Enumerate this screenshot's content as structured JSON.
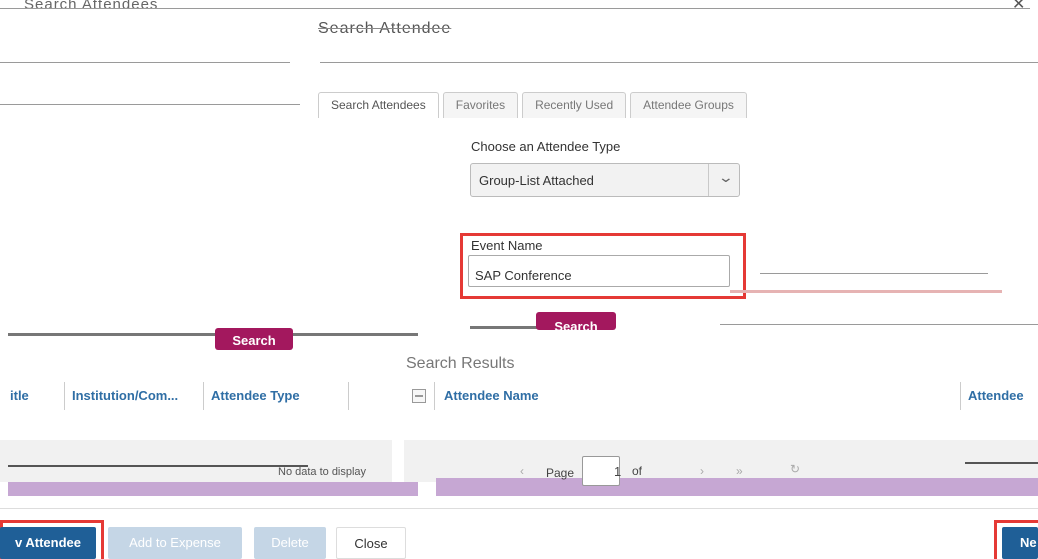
{
  "dialog": {
    "title": "Search Attendees",
    "header_center": "Search Attendee",
    "close_glyph": "✕"
  },
  "tabs": [
    {
      "label": "Search Attendees",
      "active": true
    },
    {
      "label": "Favorites",
      "active": false
    },
    {
      "label": "Recently Used",
      "active": false
    },
    {
      "label": "Attendee Groups",
      "active": false
    }
  ],
  "form": {
    "attendee_type_label": "Choose an Attendee Type",
    "attendee_type_value": "Group-List Attached",
    "event_name_label": "Event Name",
    "event_name_value": "SAP Conference",
    "search_button": "Search"
  },
  "left_grid": {
    "columns": [
      "itle",
      "Institution/Com...",
      "Attendee Type"
    ],
    "no_data": "No data to display"
  },
  "results": {
    "title": "Search Results",
    "columns": [
      "Attendee Name",
      "Attendee"
    ],
    "pager": {
      "page_label": "Page",
      "page_number": "1",
      "of_label": "of"
    }
  },
  "footer": {
    "new_attendee_left": "v Attendee",
    "add_to_expense": "Add to Expense",
    "delete": "Delete",
    "close": "Close",
    "new_attendee_right": "Ne"
  },
  "colors": {
    "brand_magenta": "#a3185e",
    "primary_blue": "#1f5f97",
    "highlight_red": "#e53935",
    "header_text_blue": "#2f6ea5",
    "pager_purple": "#c6a7d3"
  }
}
